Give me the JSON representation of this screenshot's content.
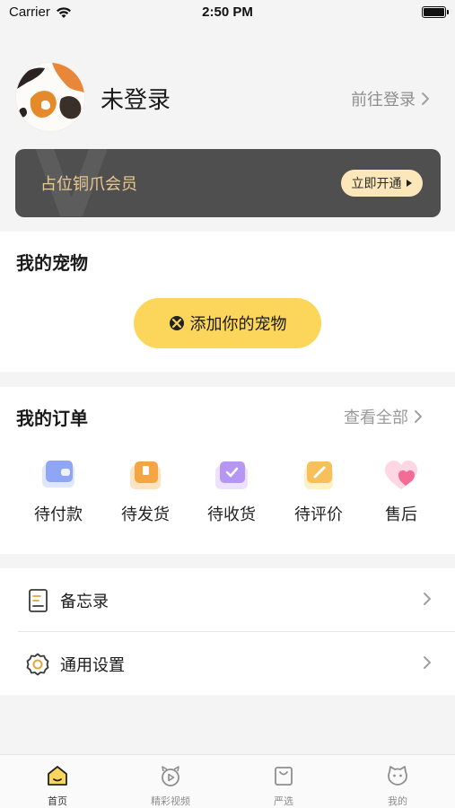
{
  "status_bar": {
    "carrier": "Carrier",
    "time": "2:50 PM"
  },
  "profile": {
    "username": "未登录",
    "login_link": "前往登录"
  },
  "member": {
    "text": "占位铜爪会员",
    "button": "立即开通"
  },
  "pets": {
    "title": "我的宠物",
    "add_button": "添加你的宠物"
  },
  "orders": {
    "title": "我的订单",
    "see_all": "查看全部",
    "items": [
      {
        "label": "待付款",
        "icon": "wallet-icon"
      },
      {
        "label": "待发货",
        "icon": "package-icon"
      },
      {
        "label": "待收货",
        "icon": "box-check-icon"
      },
      {
        "label": "待评价",
        "icon": "review-icon"
      },
      {
        "label": "售后",
        "icon": "heart-icon"
      }
    ]
  },
  "menu": [
    {
      "label": "备忘录",
      "icon": "notebook-icon"
    },
    {
      "label": "通用设置",
      "icon": "settings-gear-icon"
    }
  ],
  "tabbar": [
    {
      "label": "首页",
      "icon": "home-icon"
    },
    {
      "label": "精彩视频",
      "icon": "video-icon"
    },
    {
      "label": "严选",
      "icon": "shopping-bag-icon"
    },
    {
      "label": "我的",
      "icon": "cat-face-icon"
    }
  ],
  "colors": {
    "accent_yellow": "#fbd65a",
    "member_bg": "#4f4f4f",
    "member_text": "#e9c98f"
  }
}
